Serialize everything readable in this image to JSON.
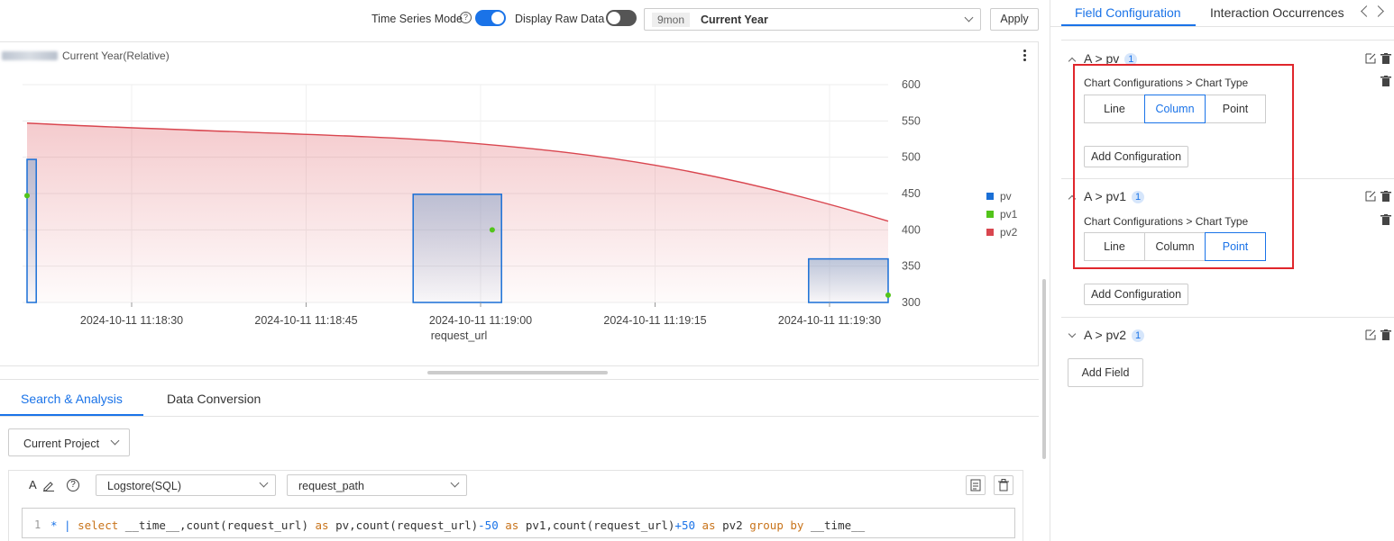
{
  "toolbar": {
    "time_series_label": "Time Series Mode",
    "raw_data_label": "Display Raw Data",
    "time_badge": "9mon",
    "time_value": "Current Year",
    "apply_label": "Apply"
  },
  "chart_panel": {
    "title": "Current Year(Relative)"
  },
  "chart_data": {
    "type": "bar",
    "xlabel": "request_url",
    "x_ticks": [
      "2024-10-11 11:18:30",
      "2024-10-11 11:18:45",
      "2024-10-11 11:19:00",
      "2024-10-11 11:19:15",
      "2024-10-11 11:19:30"
    ],
    "y_ticks": [
      600,
      550,
      500,
      450,
      400,
      350,
      300
    ],
    "ylim": [
      300,
      600
    ],
    "legend_position": "right",
    "grid": true,
    "series": [
      {
        "name": "pv",
        "type": "column",
        "color": "#1a6fd6",
        "points": [
          {
            "x": "2024-10-11 11:18:18",
            "y": 497
          },
          {
            "x": "2024-10-11 11:18:58",
            "y": 449
          },
          {
            "x": "2024-10-11 11:19:32",
            "y": 360
          }
        ]
      },
      {
        "name": "pv1",
        "type": "point",
        "color": "#52c41a",
        "points": [
          {
            "x": "2024-10-11 11:18:18",
            "y": 447
          },
          {
            "x": "2024-10-11 11:19:01",
            "y": 400
          },
          {
            "x": "2024-10-11 11:19:36",
            "y": 310
          }
        ]
      },
      {
        "name": "pv2",
        "type": "area",
        "color": "#d9464f",
        "points": [
          {
            "x": "2024-10-11 11:18:18",
            "y": 547
          },
          {
            "x": "2024-10-11 11:18:58",
            "y": 521
          },
          {
            "x": "2024-10-11 11:19:36",
            "y": 412
          }
        ]
      }
    ]
  },
  "bottom": {
    "tabs": [
      "Search & Analysis",
      "Data Conversion"
    ],
    "project_select": "Current Project",
    "store_select": "Logstore(SQL)",
    "field_select": "request_path",
    "line_no": "1",
    "query": {
      "t1": "* | ",
      "t2": "select",
      "t3": " __time__,count(request_url) ",
      "t4": "as",
      "t5": " pv,count(request_url)",
      "t6": "-50",
      "t7": " ",
      "t8": "as",
      "t9": " pv1,count(request_url)",
      "t10": "+50",
      "t11": " ",
      "t12": "as",
      "t13": " pv2 ",
      "t14": "group by",
      "t15": " __time__"
    }
  },
  "right_panel": {
    "tabs": [
      "Field Configuration",
      "Interaction Occurrences"
    ],
    "fields": [
      {
        "name": "A > pv",
        "count": "1",
        "cfg_label": "Chart Configurations > Chart Type",
        "options": [
          "Line",
          "Column",
          "Point"
        ],
        "selected": "Column",
        "add_label": "Add Configuration"
      },
      {
        "name": "A > pv1",
        "count": "1",
        "cfg_label": "Chart Configurations > Chart Type",
        "options": [
          "Line",
          "Column",
          "Point"
        ],
        "selected": "Point",
        "add_label": "Add Configuration"
      },
      {
        "name": "A > pv2",
        "count": "1"
      }
    ],
    "add_field_label": "Add Field"
  },
  "colors": {
    "accent": "#1a73e8",
    "highlight_box": "#e0262c",
    "toggle_off": "#444444"
  }
}
